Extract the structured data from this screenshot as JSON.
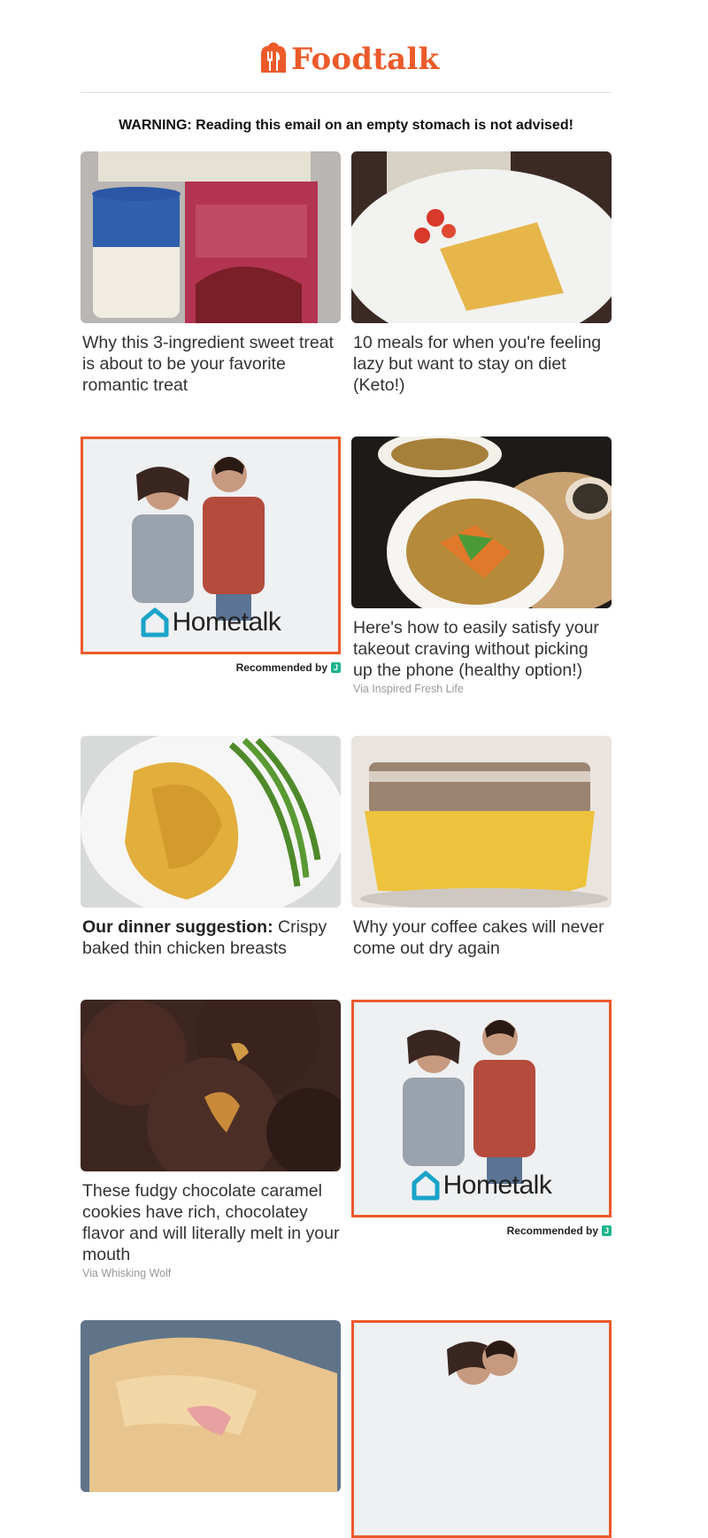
{
  "brand": {
    "name": "Foodtalk",
    "accent": "#ec5a2a"
  },
  "warning": "WARNING: Reading this email on an empty stomach is not advised!",
  "cards": [
    {
      "caption": "Why this 3-ingredient sweet treat is about to be your favorite romantic treat",
      "image": "cake-mix-ingredients-photo"
    },
    {
      "caption": "10 meals for when you're feeling lazy but want to stay on diet (Keto!)",
      "image": "keto-frittata-plate-photo"
    },
    {
      "caption": "Here's how to easily satisfy your takeout craving without picking up the phone (healthy option!)",
      "via": "Via Inspired Fresh Life",
      "image": "noodle-bowl-photo"
    },
    {
      "caption_bold": "Our dinner suggestion:",
      "caption": " Crispy baked thin chicken breasts",
      "image": "chicken-green-beans-photo"
    },
    {
      "caption": "Why your coffee cakes will never come out dry again",
      "image": "coffee-cake-slice-photo"
    },
    {
      "caption": "These fudgy chocolate caramel cookies have rich, chocolatey flavor and will literally melt in your mouth",
      "via": "Via Whisking Wolf",
      "image": "chocolate-caramel-cookies-photo"
    }
  ],
  "ads": [
    {
      "brand": "Hometalk",
      "recommended": "Recommended by"
    },
    {
      "brand": "Hometalk",
      "recommended": "Recommended by"
    }
  ]
}
